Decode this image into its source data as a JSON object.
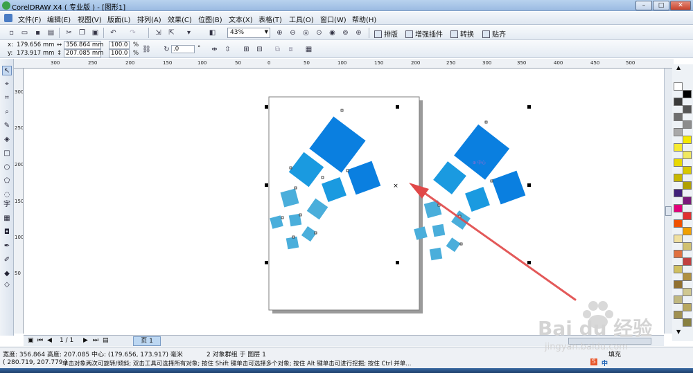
{
  "window": {
    "title": "CorelDRAW X4 ( 专业版 ) - [图形1]",
    "min_label": "–",
    "max_label": "□",
    "close_label": "✕"
  },
  "menu": [
    "文件(F)",
    "编辑(E)",
    "视图(V)",
    "版面(L)",
    "排列(A)",
    "效果(C)",
    "位图(B)",
    "文本(X)",
    "表格(T)",
    "工具(O)",
    "窗口(W)",
    "帮助(H)"
  ],
  "toolbar": {
    "zoom": "43%",
    "buttons": [
      "排版",
      "增强插件",
      "转换",
      "贴齐"
    ]
  },
  "property_bar": {
    "x_label": "x:",
    "x_value": "179.656 mm",
    "y_label": "y:",
    "y_value": "173.917 mm",
    "width_value": "356.864 mm",
    "height_value": "207.085 mm",
    "scale_w": "100.0",
    "scale_h": "100.0",
    "percent": "%",
    "rotation": ".0",
    "degree": "°"
  },
  "ruler": {
    "h_ticks": [
      "300",
      "250",
      "200",
      "150",
      "100",
      "50",
      "0",
      "50",
      "100",
      "150",
      "200",
      "250",
      "300",
      "350",
      "400",
      "450",
      "500"
    ],
    "v_ticks": [
      "300",
      "250",
      "200",
      "150",
      "100",
      "50"
    ]
  },
  "page_nav": {
    "counter": "1 / 1",
    "tab": "页 1"
  },
  "status": {
    "line1": "宽度: 356.864 高度: 207.085 中心: (179.656, 173.917) 毫米",
    "line1_right": "2 对象群组 于 图层 1",
    "line2": "( 280.719, 207.779 )",
    "line2_hint": "单击对象两次可旋转/倾斜; 双击工具可选择所有对象; 按住 Shift 键单击可选择多个对象; 按住 Alt 键单击可进行挖掘; 按住 Ctrl 并单...",
    "fill_label": "填充"
  },
  "watermark": {
    "brand": "Bai du 经验",
    "url": "jingyan.baidu.com"
  },
  "colors": {
    "square_dark": "#0a7fe0",
    "square_mid": "#1a9ae0",
    "square_light": "#4aaedb",
    "arrow": "#e04848"
  },
  "palette_colors": [
    "#ffffff",
    "#000000",
    "#3a3a3a",
    "#555555",
    "#6f6f6f",
    "#8c8c8c",
    "#a9a9a9",
    "#f4e800",
    "#f6ea30",
    "#f0e860",
    "#e8d800",
    "#d8c800",
    "#c8b800",
    "#b0a000",
    "#40207a",
    "#7a1a7a",
    "#e0007a",
    "#e03030",
    "#f05000",
    "#f0a000",
    "#f0e0a0",
    "#d0c070",
    "#e07040",
    "#c04040",
    "#d0c060",
    "#b09040",
    "#907030",
    "#d0c890",
    "#c0b880",
    "#b8a860",
    "#a09050",
    "#888040"
  ]
}
